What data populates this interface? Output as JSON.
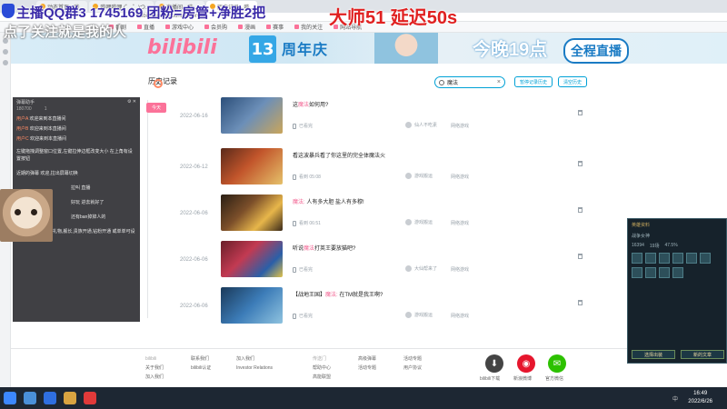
{
  "browser": {
    "tabs": [
      "动态首页 - 哔...",
      "哔哩哔哩 (゜-゜)つ...",
      "直播间 - 哔...",
      "历史记录 - 哔..."
    ],
    "url": "bilibili.com/account/history",
    "bookmarks": [
      "番剧",
      "直播",
      "游戏中心",
      "会员购",
      "漫画",
      "赛事",
      "我的关注",
      "网站导航"
    ]
  },
  "header": {
    "logo": "bilibili",
    "anniv_num": "13",
    "anniv_text": "周年庆",
    "tonight": "今晚19点",
    "live_label": "全程直播"
  },
  "history": {
    "title": "历史记录",
    "today_tag": "今天",
    "search": {
      "value": "魔法",
      "clear": "×"
    },
    "pause_label": "暂停记录历史",
    "clear_label": "清空历史",
    "entries": [
      {
        "date": "2022-06-16",
        "title_pre": "这",
        "title_hl": "魔法",
        "title_post": "如何用?",
        "device": "已看完",
        "up": "仙人不吃素",
        "category": "网络游戏"
      },
      {
        "date": "2022-06-12",
        "title_pre": "看这波暴兵",
        "title_hl": "",
        "title_post": "看了你这里的完全体魔法火",
        "device": "看到 05:08",
        "up": "游戏搬运",
        "category": "网络游戏"
      },
      {
        "date": "2022-06-06",
        "title_pre": "",
        "title_hl": "魔法:",
        "title_post": " 人有多大胆 盐人有多穆!",
        "device": "看到 06:51",
        "up": "游戏搬运",
        "category": "网络游戏"
      },
      {
        "date": "2022-06-06",
        "title_pre": "听说",
        "title_hl": "魔法",
        "title_post": "打英王要放猫吧?",
        "device": "已看完",
        "up": "大仙帮来了",
        "category": "网络游戏"
      },
      {
        "date": "2022-06-06",
        "title_pre": "【战地王国】",
        "title_hl": "魔法:",
        "title_post": " 在TM就是我王啊?",
        "device": "已看完",
        "up": "游戏搬运",
        "category": "网络游戏"
      }
    ]
  },
  "footer": {
    "col1": {
      "head": "bilibili",
      "items": [
        "关于我们",
        "加入我们"
      ]
    },
    "col2": {
      "head": "",
      "items": [
        "联系我们",
        "bilibili认证"
      ]
    },
    "col3": {
      "head": "",
      "items": [
        "加入我们",
        "Investor Relations"
      ]
    },
    "col4": {
      "head": "传送门",
      "items": [
        "帮助中心",
        "高能联盟"
      ]
    },
    "col5": {
      "head": "",
      "items": [
        "高级弹幕",
        "活动专题"
      ]
    },
    "col6": {
      "head": "",
      "items": [
        "活动专题",
        "用户协议"
      ]
    },
    "apps": [
      "bilibili下载",
      "新浪微博",
      "官方微信"
    ]
  },
  "chat": {
    "title": "弹幕助手",
    "stats": [
      "180700",
      "1"
    ],
    "lines": [
      {
        "name": "用户A",
        "text": "欢迎来到本直播间"
      },
      {
        "name": "用户B",
        "text": "欢迎来到本直播间"
      },
      {
        "name": "用户C",
        "text": "欢迎来到本直播间"
      }
    ],
    "para1": "左键拖拽调整窗口位置,左键拉伸边框改变大小 在上角有设置按钮",
    "para2": "近期的弹幕 欢迎,拉出屏幕切换",
    "para3": "这里展示你收到的礼物,舰长,贵族开通,钻粉开通 或单单可设置小礼物屏蔽",
    "snippets": [
      "拉叫 直播",
      "好玩 进去就好了",
      "还有ban掉掉人的"
    ]
  },
  "overlay": {
    "line1": "主播QQ群3 1745169 团粉=房管+净胜2把",
    "line2": "点了关注就是我的人",
    "line3": "大师51 延迟50s"
  },
  "game": {
    "title": "英雄资料",
    "hero": "战争女神",
    "stats": [
      "16394",
      "19场",
      "47.5%"
    ],
    "btn1": "选择出装",
    "btn2": "新的文章"
  },
  "taskbar": {
    "time": "16:49",
    "date": "2022/6/26",
    "ime": "中"
  }
}
